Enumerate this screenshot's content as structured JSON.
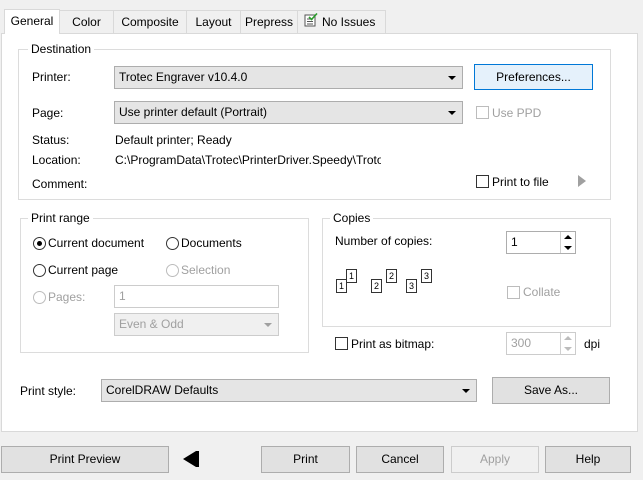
{
  "tabs": [
    {
      "label": "General",
      "active": true
    },
    {
      "label": "Color"
    },
    {
      "label": "Composite"
    },
    {
      "label": "Layout"
    },
    {
      "label": "Prepress"
    },
    {
      "label": "No Issues",
      "icon": "checklist-icon"
    }
  ],
  "destination": {
    "title": "Destination",
    "printer_label": "Printer:",
    "printer_value": "Trotec Engraver v10.4.0",
    "preferences_label": "Preferences...",
    "page_label": "Page:",
    "page_value": "Use printer default (Portrait)",
    "use_ppd_label": "Use PPD",
    "status_label": "Status:",
    "status_value": "Default printer; Ready",
    "location_label": "Location:",
    "location_value": "C:\\ProgramData\\Trotec\\PrinterDriver.Speedy\\Troto",
    "comment_label": "Comment:",
    "print_to_file_label": "Print to file"
  },
  "print_range": {
    "title": "Print range",
    "current_document": "Current document",
    "documents": "Documents",
    "current_page": "Current page",
    "selection": "Selection",
    "pages_label": "Pages:",
    "pages_value": "1",
    "even_odd_value": "Even & Odd"
  },
  "copies": {
    "title": "Copies",
    "number_label": "Number of copies:",
    "number_value": "1",
    "collate_label": "Collate",
    "pages_icon_1": [
      "1",
      "1"
    ],
    "pages_icon_2": [
      "2",
      "2"
    ],
    "pages_icon_3": [
      "3",
      "3"
    ]
  },
  "bitmap": {
    "label": "Print as bitmap:",
    "value": "300",
    "unit": "dpi"
  },
  "print_style": {
    "label": "Print style:",
    "value": "CorelDRAW Defaults",
    "save_as_label": "Save As..."
  },
  "footer": {
    "print_preview": "Print Preview",
    "print": "Print",
    "cancel": "Cancel",
    "apply": "Apply",
    "help": "Help"
  }
}
